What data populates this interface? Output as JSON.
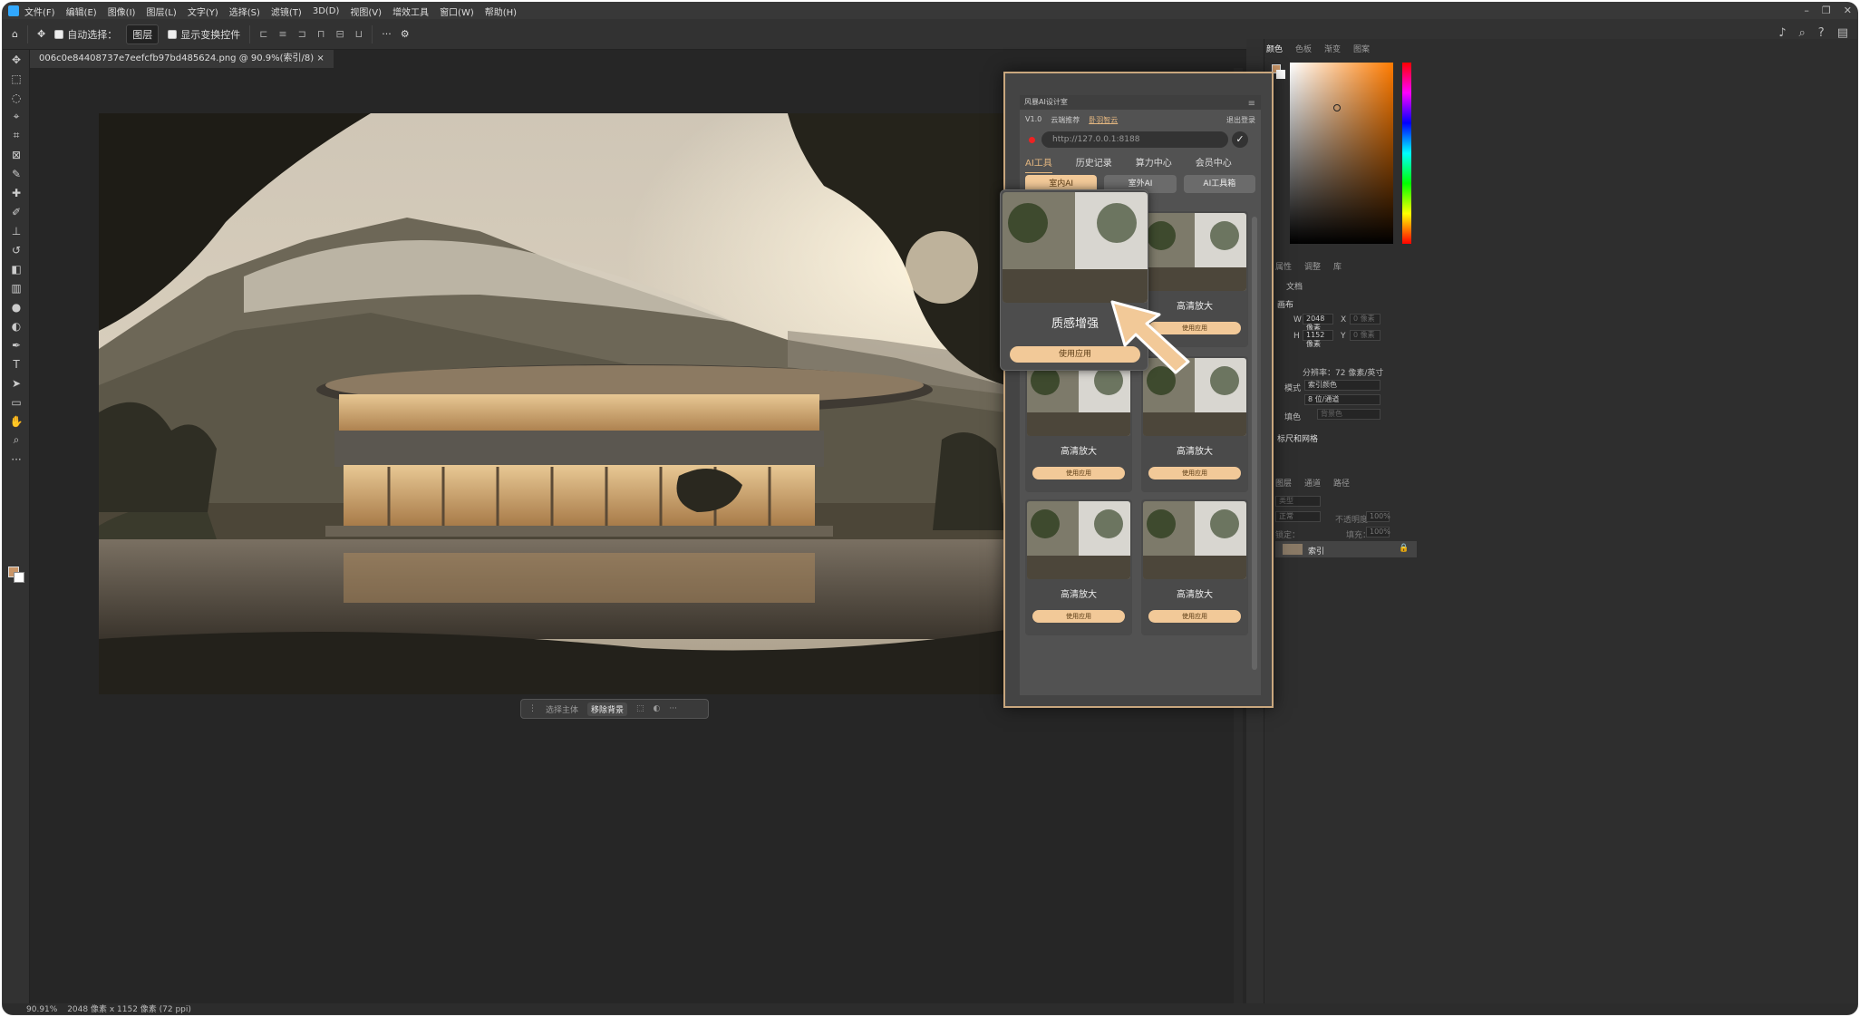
{
  "menu": [
    "文件(F)",
    "编辑(E)",
    "图像(I)",
    "图层(L)",
    "文字(Y)",
    "选择(S)",
    "滤镜(T)",
    "3D(D)",
    "视图(V)",
    "增效工具",
    "窗口(W)",
    "帮助(H)"
  ],
  "options": {
    "auto_select_label": "自动选择：",
    "auto_select_value": "图层",
    "show_transform_label": "显示变换控件"
  },
  "document": {
    "tab_title": "006c0e84408737e7eefcfb97bd485624.png @ 90.9%(索引/8)",
    "tab_close": "×"
  },
  "context_bar": {
    "select_subject": "选择主体",
    "remove_bg": "移除背景"
  },
  "status": {
    "zoom": "90.91%",
    "doc_info": "2048 像素 x 1152 像素 (72 ppi)"
  },
  "color_panel": {
    "tabs": [
      "颜色",
      "色板",
      "渐变",
      "图案"
    ],
    "fg": "#c99567",
    "bg": "#ffffff"
  },
  "properties": {
    "tabs": [
      "属性",
      "调整",
      "库"
    ],
    "doc_label": "文档",
    "canvas_label": "画布",
    "w_label": "W",
    "w_value": "2048 像素",
    "h_label": "H",
    "h_value": "1152 像素",
    "x_label": "X",
    "x_placeholder": "0 像素",
    "y_label": "Y",
    "y_placeholder": "0 像素",
    "resolution": "分辨率：72 像素/英寸",
    "mode_label": "模式",
    "mode_value": "索引颜色",
    "depth_value": "8 位/通道",
    "fill_label": "填色",
    "fill_value": "背景色",
    "rulers_label": "标尺和网格"
  },
  "layers": {
    "tabs": [
      "图层",
      "通道",
      "路径"
    ],
    "kind_placeholder": "类型",
    "blend": "正常",
    "opacity_label": "不透明度：",
    "opacity_value": "100%",
    "lock_label": "锁定：",
    "fill_label": "填充：",
    "fill_value": "100%",
    "layer_name": "索引"
  },
  "plugin": {
    "title": "风暴AI设计室",
    "version": "V1.0",
    "cloud_label": "云端推荐",
    "brand": "卧羽智云",
    "logout": "退出登录",
    "url": "http://127.0.0.1:8188",
    "confirm": "✓",
    "tabs": [
      "AI工具",
      "历史记录",
      "算力中心",
      "会员中心"
    ],
    "subtabs": [
      "室内AI",
      "室外AI",
      "AI工具箱"
    ],
    "highlight": {
      "title": "质感增强",
      "button": "使用应用"
    },
    "cards": [
      {
        "title": "高清放大",
        "button": "使用应用"
      },
      {
        "title": "高清放大",
        "button": "使用应用"
      },
      {
        "title": "高清放大",
        "button": "使用应用"
      },
      {
        "title": "高清放大",
        "button": "使用应用"
      },
      {
        "title": "高清放大",
        "button": "使用应用"
      }
    ]
  }
}
